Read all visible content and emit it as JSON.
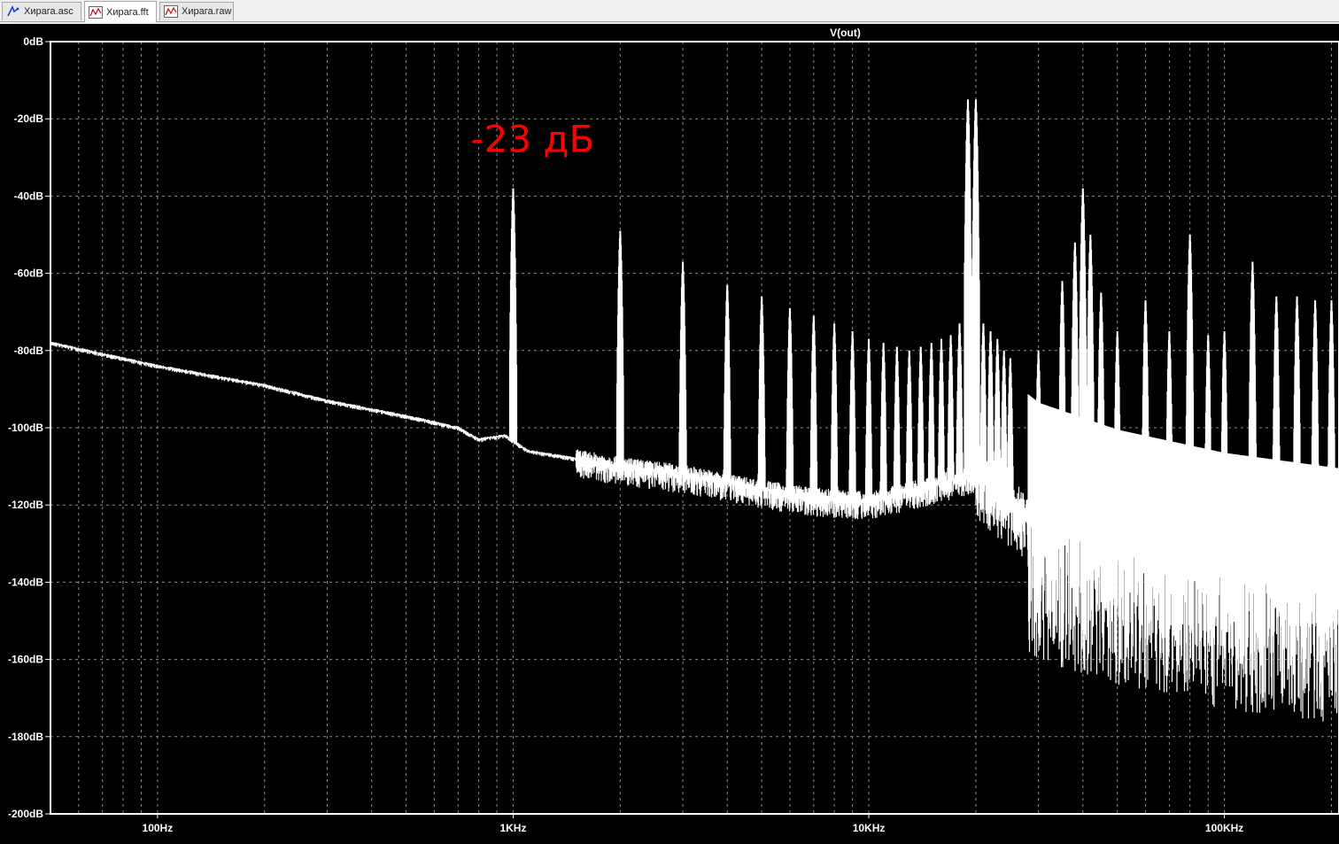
{
  "tabs": [
    {
      "label": "Хирага.asc",
      "icon": "schematic-icon"
    },
    {
      "label": "Хирага.fft",
      "icon": "waveform-icon",
      "active": true
    },
    {
      "label": "Хирага.raw",
      "icon": "waveform-icon"
    }
  ],
  "colors": {
    "background": "#000000",
    "trace": "#ffffff",
    "axis_text": "#ffffff",
    "annotation": "#ff0000",
    "grid": "#8c8c8c"
  },
  "annotation": {
    "text": "-23 дБ",
    "x_hz": 1000,
    "y_db": -23
  },
  "chart_data": {
    "type": "line",
    "title": "V(out)",
    "xscale": "log",
    "xlim": [
      50,
      210000
    ],
    "ylim": [
      -200,
      0
    ],
    "grid": true,
    "x_ticks": [
      {
        "value": 100,
        "label": "100Hz"
      },
      {
        "value": 1000,
        "label": "1KHz"
      },
      {
        "value": 10000,
        "label": "10KHz"
      },
      {
        "value": 100000,
        "label": "100KHz"
      }
    ],
    "y_ticks": [
      {
        "value": 0,
        "label": "0dB"
      },
      {
        "value": -20,
        "label": "-20dB"
      },
      {
        "value": -40,
        "label": "-40dB"
      },
      {
        "value": -60,
        "label": "-60dB"
      },
      {
        "value": -80,
        "label": "-80dB"
      },
      {
        "value": -100,
        "label": "-100dB"
      },
      {
        "value": -120,
        "label": "-120dB"
      },
      {
        "value": -140,
        "label": "-140dB"
      },
      {
        "value": -160,
        "label": "-160dB"
      },
      {
        "value": -180,
        "label": "-180dB"
      },
      {
        "value": -200,
        "label": "-200dB"
      }
    ],
    "noise_floor": [
      [
        50,
        -78
      ],
      [
        100,
        -84
      ],
      [
        200,
        -89
      ],
      [
        300,
        -93
      ],
      [
        500,
        -97
      ],
      [
        700,
        -100
      ],
      [
        800,
        -103
      ],
      [
        950,
        -102
      ],
      [
        1100,
        -106
      ],
      [
        1500,
        -108
      ],
      [
        2000,
        -110
      ],
      [
        3000,
        -112
      ],
      [
        5000,
        -116
      ],
      [
        7000,
        -118
      ],
      [
        10000,
        -119
      ],
      [
        15000,
        -115
      ],
      [
        20000,
        -112
      ],
      [
        30000,
        -125
      ],
      [
        50000,
        -132
      ],
      [
        100000,
        -138
      ],
      [
        210000,
        -142
      ]
    ],
    "harmonic_peaks": [
      [
        1000,
        -38
      ],
      [
        2000,
        -49
      ],
      [
        3000,
        -57
      ],
      [
        4000,
        -63
      ],
      [
        5000,
        -66
      ],
      [
        6000,
        -69
      ],
      [
        7000,
        -71
      ],
      [
        8000,
        -73
      ],
      [
        9000,
        -75
      ],
      [
        10000,
        -77
      ],
      [
        11000,
        -78
      ],
      [
        12000,
        -79
      ],
      [
        13000,
        -80
      ],
      [
        14000,
        -79
      ],
      [
        15000,
        -78
      ],
      [
        16000,
        -77
      ],
      [
        17000,
        -76
      ],
      [
        18000,
        -73
      ],
      [
        19000,
        -15
      ],
      [
        20000,
        -15
      ],
      [
        21000,
        -73
      ],
      [
        22000,
        -75
      ],
      [
        23000,
        -77
      ],
      [
        24000,
        -80
      ],
      [
        25000,
        -82
      ],
      [
        30000,
        -80
      ],
      [
        35000,
        -62
      ],
      [
        38000,
        -52
      ],
      [
        40000,
        -38
      ],
      [
        42000,
        -50
      ],
      [
        45000,
        -65
      ],
      [
        50000,
        -75
      ],
      [
        60000,
        -67
      ],
      [
        70000,
        -75
      ],
      [
        80000,
        -50
      ],
      [
        90000,
        -76
      ],
      [
        100000,
        -75
      ],
      [
        120000,
        -57
      ],
      [
        140000,
        -66
      ],
      [
        160000,
        -66
      ],
      [
        180000,
        -67
      ],
      [
        200000,
        -67
      ]
    ]
  }
}
